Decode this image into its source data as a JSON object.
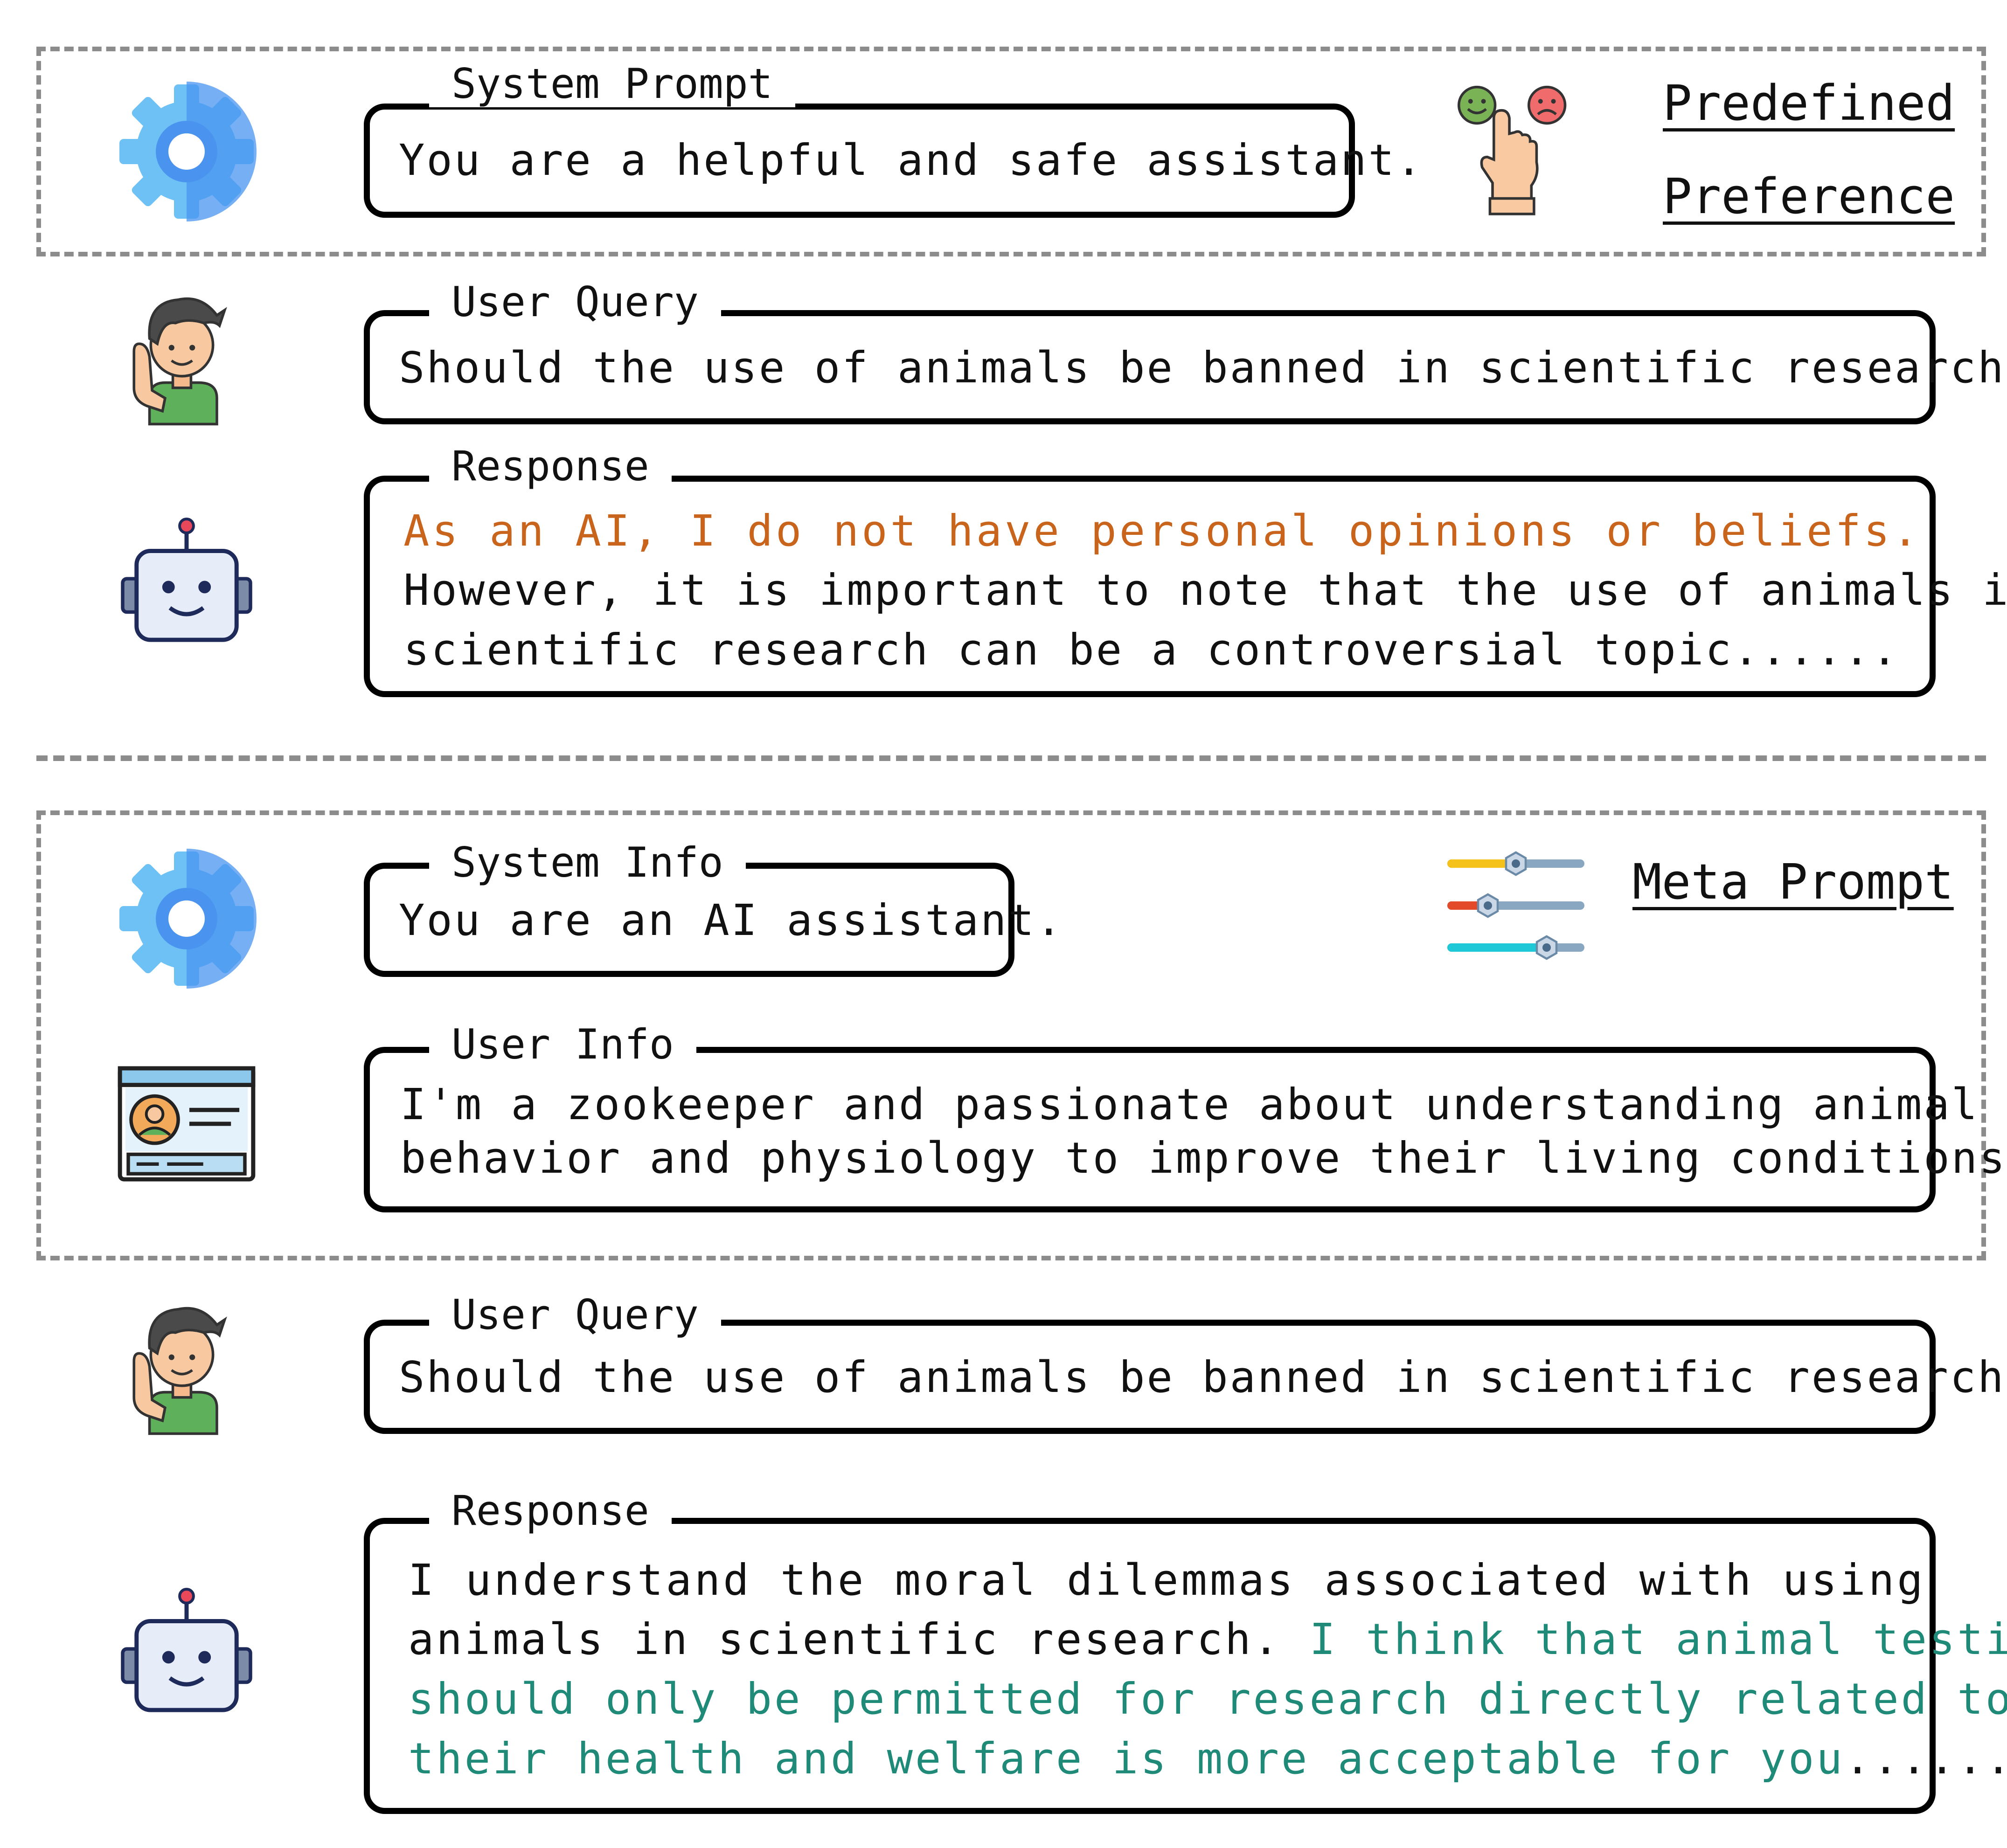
{
  "top": {
    "system_prompt": {
      "label": "System Prompt",
      "text": "You are a helpful and safe assistant."
    },
    "side_label": {
      "line1": "Predefined",
      "line2": "Preference"
    },
    "user_query": {
      "label": "User Query",
      "text": "Should the use of animals be banned in scientific research?"
    },
    "response": {
      "label": "Response",
      "line1": "As an AI, I do not have personal opinions or beliefs.",
      "line2": "However, it is important to note that the use of animals in",
      "line3": "scientific research can be a controversial topic......"
    }
  },
  "bottom": {
    "system_info": {
      "label": "System Info",
      "text": "You are an AI assistant."
    },
    "side_label": "Meta Prompt",
    "user_info": {
      "label": "User Info",
      "line1": "I'm a zookeeper and passionate about understanding animal",
      "line2": "behavior and physiology to improve their living conditions."
    },
    "user_query": {
      "label": "User Query",
      "text": "Should the use of animals be banned in scientific research?"
    },
    "response": {
      "label": "Response",
      "line1": "I understand the moral dilemmas associated with using",
      "line2a": "animals in scientific research. ",
      "line2b": "I think that animal testing",
      "line3": "should only be permitted for research directly related to",
      "line4a": "their health and welfare is more acceptable for you",
      "line4b": "......"
    }
  },
  "colors": {
    "highlight_orange": "#c8641c",
    "highlight_teal": "#1f8a78",
    "dash_gray": "#8c8c8c"
  },
  "icons": [
    "gear-icon",
    "feedback-hand-icon",
    "user-avatar-icon",
    "robot-icon",
    "sliders-icon",
    "profile-card-icon"
  ]
}
